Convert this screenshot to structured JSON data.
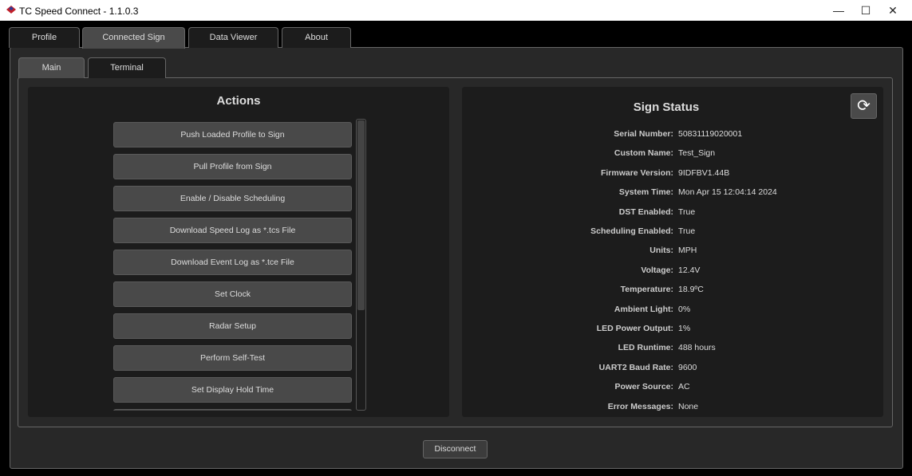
{
  "window": {
    "title": "TC Speed Connect - 1.1.0.3",
    "minimize": "—",
    "maximize": "☐",
    "close": "✕"
  },
  "tabs": [
    "Profile",
    "Connected Sign",
    "Data Viewer",
    "About"
  ],
  "subtabs": [
    "Main",
    "Terminal"
  ],
  "actions": {
    "title": "Actions",
    "buttons": [
      "Push Loaded Profile to Sign",
      "Pull Profile from Sign",
      "Enable / Disable Scheduling",
      "Download Speed Log as *.tcs File",
      "Download Event Log as *.tce File",
      "Set Clock",
      "Radar Setup",
      "Perform Self-Test",
      "Set Display Hold Time"
    ],
    "scroll_fraction": 0.65
  },
  "status": {
    "title": "Sign Status",
    "refresh_icon": "⟳",
    "rows": [
      {
        "label": "Serial Number:",
        "value": "50831119020001"
      },
      {
        "label": "Custom Name:",
        "value": "Test_Sign"
      },
      {
        "label": "Firmware Version:",
        "value": "9IDFBV1.44B"
      },
      {
        "label": "System Time:",
        "value": "Mon Apr 15 12:04:14 2024"
      },
      {
        "label": "DST Enabled:",
        "value": "True"
      },
      {
        "label": "Scheduling Enabled:",
        "value": "True"
      },
      {
        "label": "Units:",
        "value": "MPH"
      },
      {
        "label": "Voltage:",
        "value": "12.4V"
      },
      {
        "label": "Temperature:",
        "value": "18.9ºC"
      },
      {
        "label": "Ambient Light:",
        "value": "0%"
      },
      {
        "label": "LED Power Output:",
        "value": "1%"
      },
      {
        "label": "LED Runtime:",
        "value": "488 hours"
      },
      {
        "label": "UART2 Baud Rate:",
        "value": "9600"
      },
      {
        "label": "Power Source:",
        "value": "AC"
      },
      {
        "label": "Error Messages:",
        "value": "None"
      }
    ]
  },
  "disconnect": "Disconnect"
}
